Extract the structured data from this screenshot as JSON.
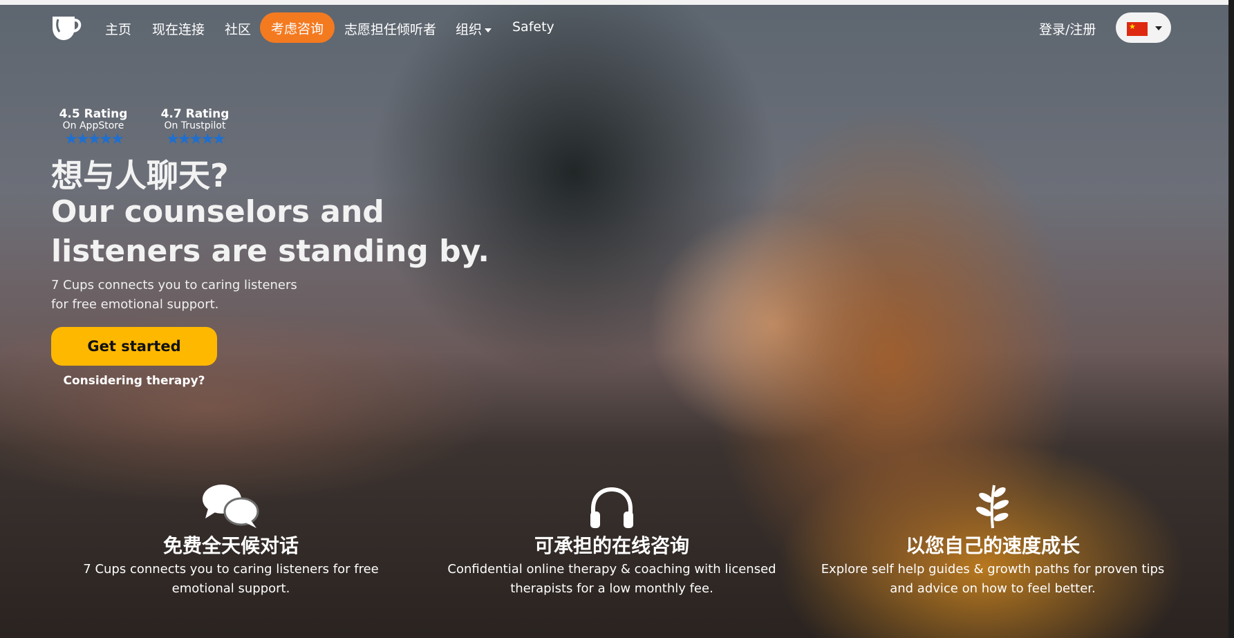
{
  "nav": {
    "home": "主页",
    "connect_now": "现在连接",
    "community": "社区",
    "consider_counseling": "考虑咨询",
    "volunteer": "志愿担任倾听者",
    "organization": "组织",
    "safety": "Safety",
    "login": "登录/注册"
  },
  "ratings": [
    {
      "title": "4.5 Rating",
      "source": "On AppStore",
      "stars": "★★★★★"
    },
    {
      "title": "4.7 Rating",
      "source": "On Trustpilot",
      "stars": "★★★★★"
    }
  ],
  "hero": {
    "headline_cn": "想与人聊天?",
    "headline_en": "Our counselors and listeners are standing by.",
    "subtext": "7 Cups connects you to caring listeners for free emotional support.",
    "cta": "Get started",
    "therapy_link": "Considering therapy?"
  },
  "features": [
    {
      "icon": "chat-bubbles-icon",
      "title": "免费全天候对话",
      "text": "7 Cups connects you to caring listeners for free emotional support."
    },
    {
      "icon": "headphones-icon",
      "title": "可承担的在线咨询",
      "text": "Confidential online therapy & coaching with licensed therapists for a low monthly fee."
    },
    {
      "icon": "sprout-icon",
      "title": "以您自己的速度成长",
      "text": "Explore self help guides & growth paths for proven tips and advice on how to feel better."
    }
  ],
  "colors": {
    "accent_orange": "#f47a20",
    "cta_yellow": "#ffb800",
    "star_blue": "#1e6fd0"
  }
}
